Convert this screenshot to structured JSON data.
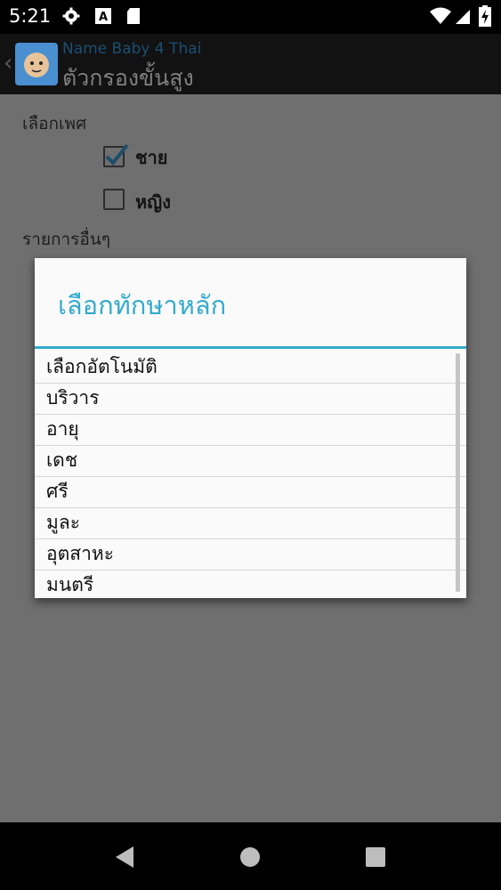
{
  "status_bar": {
    "time": "5:21",
    "icons": [
      "gear-icon",
      "a-accessibility-icon",
      "sd-card-icon",
      "wifi-icon",
      "signal-icon",
      "battery-charging-icon"
    ]
  },
  "action_bar": {
    "app_name": "Name Baby 4 Thai",
    "screen_title": "ตัวกรองขั้นสูง"
  },
  "background": {
    "gender_label": "เลือกเพศ",
    "male_label": "ชาย",
    "male_checked": true,
    "female_label": "หญิง",
    "female_checked": false,
    "other_label": "รายการอื่นๆ"
  },
  "dialog": {
    "title": "เลือกทักษาหลัก",
    "items": [
      "เลือกอัตโนมัติ",
      "บริวาร",
      "อายุ",
      "เดช",
      "ศรี",
      "มูละ",
      "อุตสาหะ",
      "มนตรี"
    ]
  },
  "nav_bar": {
    "buttons": [
      "back-icon",
      "home-icon",
      "recents-icon"
    ]
  },
  "colors": {
    "accent": "#33aacc",
    "scrim": "#6f6f70"
  }
}
